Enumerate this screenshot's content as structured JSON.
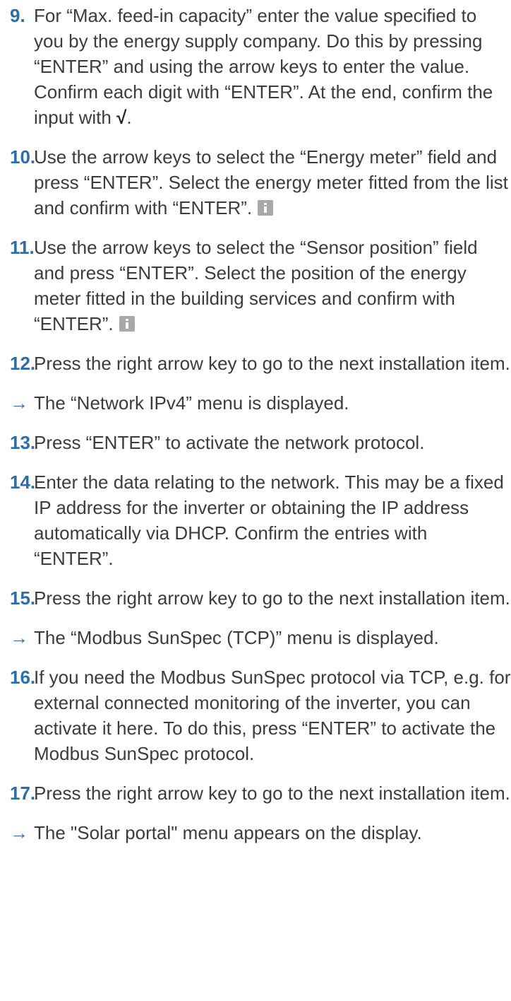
{
  "steps": [
    {
      "marker": "9.",
      "text": "For “Max. feed-in capacity” enter the value specified to you by the energy supply company. Do this by pressing “ENTER” and using the arrow keys to enter the value. Confirm each digit with “ENTER”. At the end, confirm the input with ",
      "check": "√",
      "after": ".",
      "info": false
    },
    {
      "marker": "10.",
      "text": "Use the arrow keys to select the “Energy meter” field and press “ENTER”. Select the energy meter fitted from the list and confirm with “ENTER”.",
      "info": true
    },
    {
      "marker": "11.",
      "text": "Use the arrow keys to select the “Sensor position” field and press “ENTER”. Select the position of the energy meter fitted in the building services and confirm with “ENTER”.",
      "info": true
    },
    {
      "marker": "12.",
      "text": "Press the right arrow key to go to the next installation item.",
      "info": false
    },
    {
      "marker": "→",
      "text": "The “Network IPv4” menu is displayed.",
      "info": false
    },
    {
      "marker": "13.",
      "text": "Press “ENTER” to activate the network protocol.",
      "info": false
    },
    {
      "marker": "14.",
      "text": "Enter the data relating to the network. This may be a fixed IP address for the inverter or obtaining the IP address automatically via DHCP. Confirm the entries with “ENTER”.",
      "info": false
    },
    {
      "marker": "15.",
      "text": "Press the right arrow key to go to the next installation item.",
      "info": false
    },
    {
      "marker": "→",
      "text": "The “Modbus SunSpec (TCP)” menu is displayed.",
      "info": false
    },
    {
      "marker": "16.",
      "text": "If you need the Modbus SunSpec protocol via TCP, e.g. for external connected monitoring of the inverter, you can activate it here. To do this, press “ENTER” to activate the Modbus SunSpec protocol.",
      "info": false
    },
    {
      "marker": "17.",
      "text": "Press the right arrow key to go to the next installation item.",
      "info": false
    },
    {
      "marker": "→",
      "text": "The \"Solar portal\" menu appears on the display.",
      "info": false
    }
  ]
}
